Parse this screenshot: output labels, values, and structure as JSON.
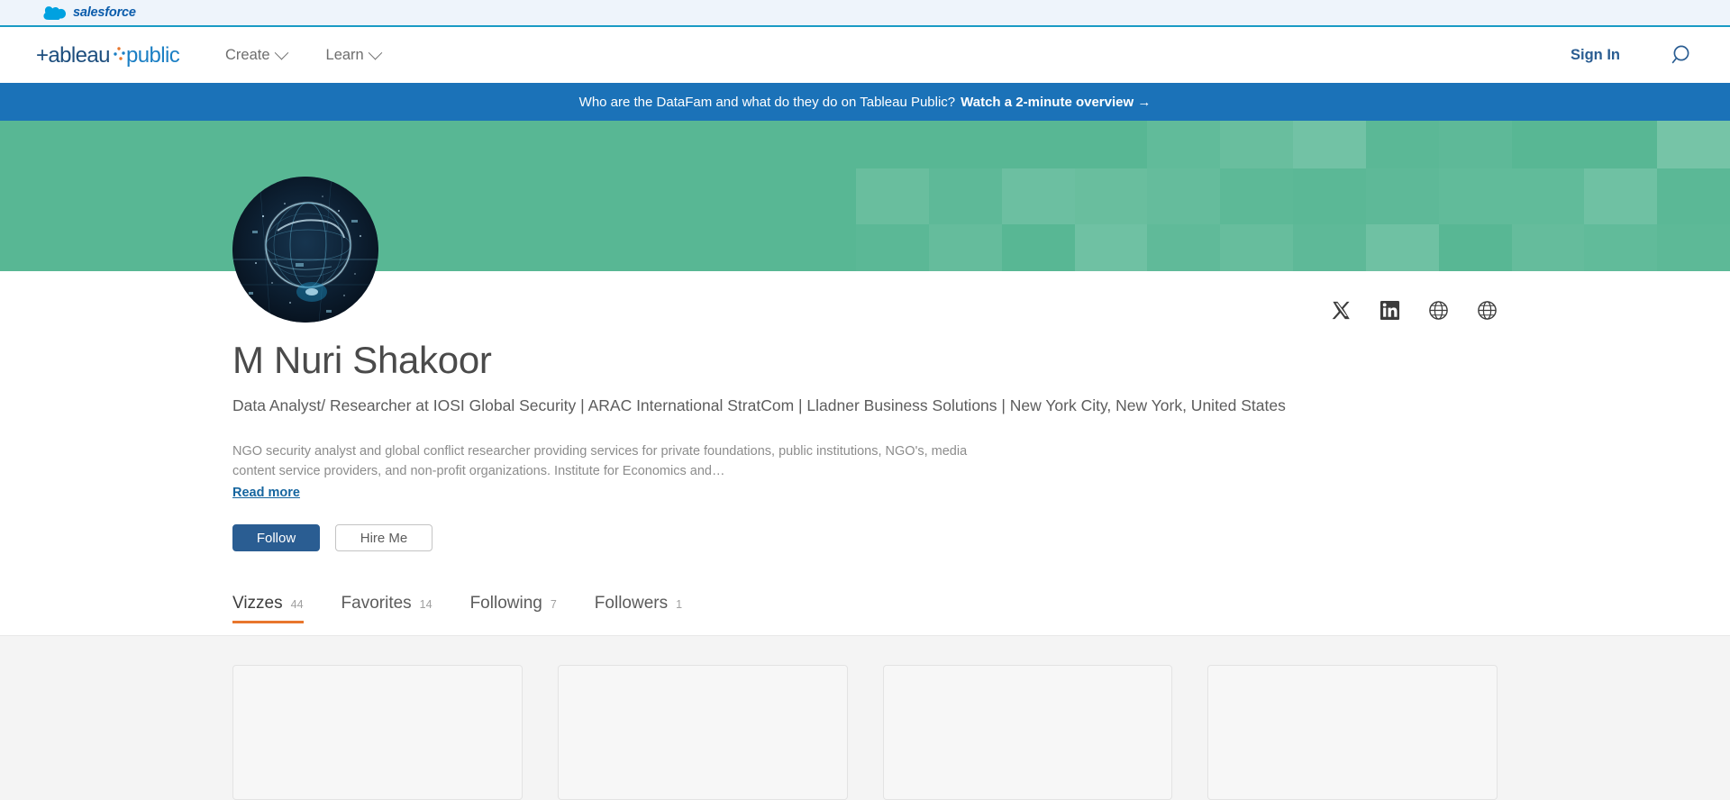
{
  "salesforce_bar": {
    "brand": "salesforce",
    "icon": "salesforce-cloud-icon"
  },
  "nav": {
    "logo_text": "tableau public",
    "links": [
      {
        "label": "Create",
        "icon": "chevron-down-icon"
      },
      {
        "label": "Learn",
        "icon": "chevron-down-icon"
      }
    ],
    "sign_in": "Sign In",
    "search_icon": "search-icon"
  },
  "promo": {
    "text": "Who are the DataFam and what do they do on Tableau Public?",
    "cta": "Watch a 2-minute overview →"
  },
  "hero": {
    "background_color": "#58b794",
    "mosaic_columns": 12,
    "mosaic_rows": 3
  },
  "profile": {
    "avatar_alt": "digital globe network avatar",
    "name": "M Nuri Shakoor",
    "title": "Data Analyst/ Researcher at IOSI Global Security | ARAC International StratCom | Lladner Business Solutions | New York City, New York, United States",
    "bio": "NGO security analyst and global conflict researcher providing services for private foundations, public institutions, NGO's, media content service providers, and non-profit organizations. Institute for Economics and…",
    "read_more": "Read more",
    "buttons": {
      "follow": "Follow",
      "hire_me": "Hire Me"
    },
    "socials": [
      {
        "name": "twitter-x-icon",
        "label": "X"
      },
      {
        "name": "linkedin-icon",
        "label": "LinkedIn"
      },
      {
        "name": "website-globe-icon",
        "label": "Website"
      },
      {
        "name": "website-globe-icon-2",
        "label": "Website 2"
      }
    ]
  },
  "tabs": [
    {
      "label": "Vizzes",
      "count": "44",
      "active": true
    },
    {
      "label": "Favorites",
      "count": "14",
      "active": false
    },
    {
      "label": "Following",
      "count": "7",
      "active": false
    },
    {
      "label": "Followers",
      "count": "1",
      "active": false
    }
  ],
  "cards": [
    {
      "placeholder": ""
    },
    {
      "placeholder": ""
    },
    {
      "placeholder": ""
    },
    {
      "placeholder": ""
    }
  ],
  "colors": {
    "accent_orange": "#e8762d",
    "brand_blue": "#2a5d92",
    "promo_blue": "#1b72b8",
    "hero_green": "#58b794",
    "link_blue": "#15659f"
  }
}
